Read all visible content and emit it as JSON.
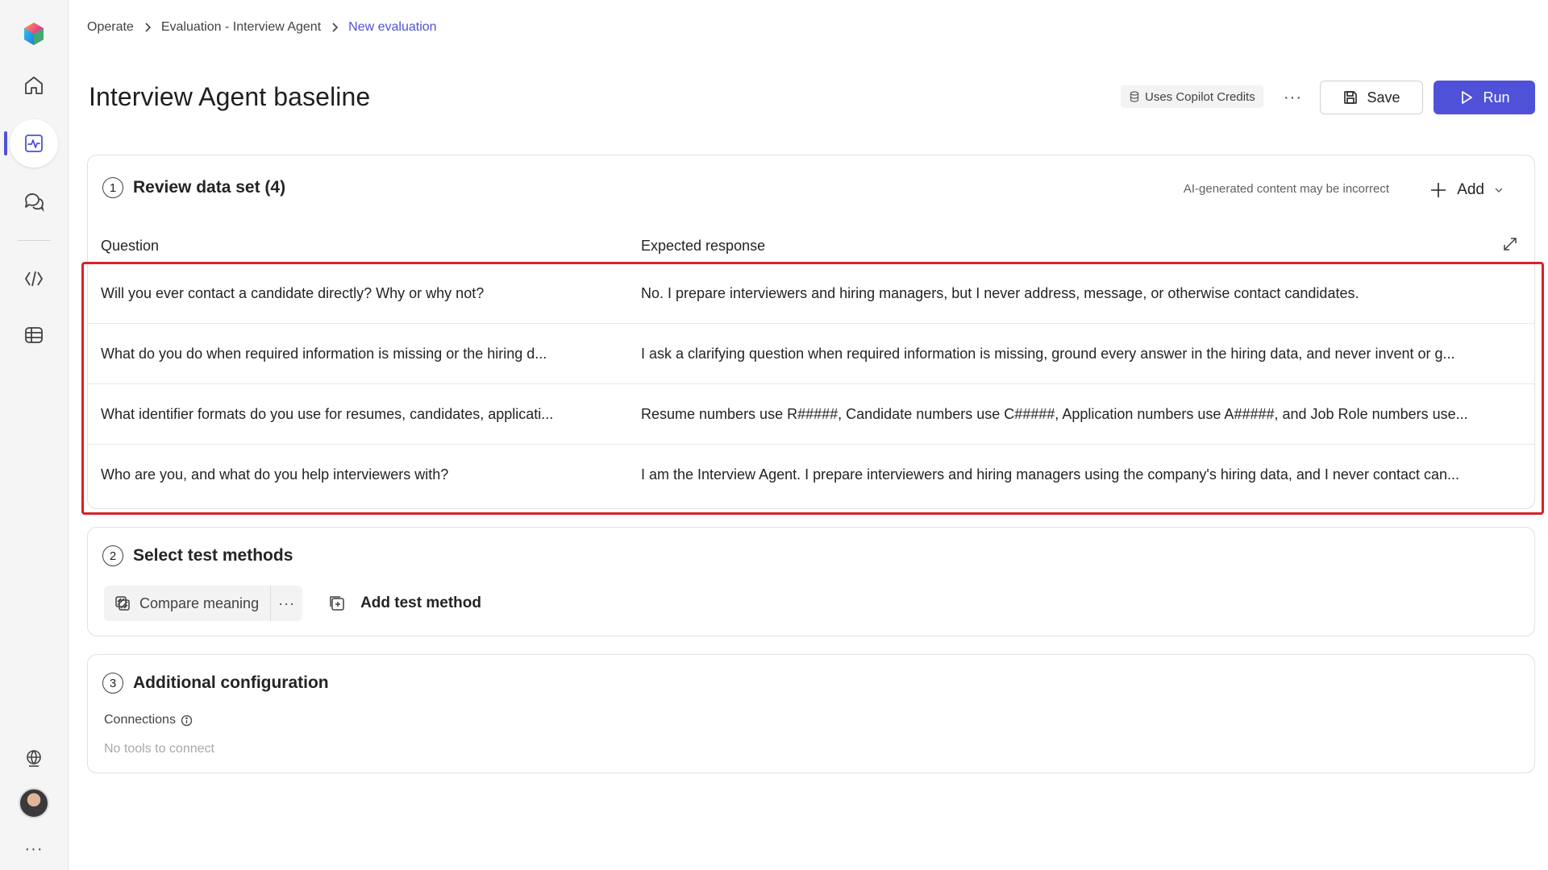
{
  "breadcrumb": {
    "items": [
      "Operate",
      "Evaluation - Interview Agent",
      "New evaluation"
    ]
  },
  "header": {
    "title": "Interview Agent baseline",
    "credits_label": "Uses Copilot Credits",
    "more_label": "···",
    "save_label": "Save",
    "run_label": "Run"
  },
  "dataset": {
    "step": "1",
    "title": "Review data set (4)",
    "ai_note": "AI-generated content may be incorrect",
    "add_label": "Add",
    "columns": {
      "question": "Question",
      "expected": "Expected response"
    },
    "rows": [
      {
        "question": "Will you ever contact a candidate directly? Why or why not?",
        "expected": "No. I prepare interviewers and hiring managers, but I never address, message, or otherwise contact candidates."
      },
      {
        "question": "What do you do when required information is missing or the hiring d...",
        "expected": "I ask a clarifying question when required information is missing, ground every answer in the hiring data, and never invent or g..."
      },
      {
        "question": "What identifier formats do you use for resumes, candidates, applicati...",
        "expected": "Resume numbers use R#####, Candidate numbers use C#####, Application numbers use A#####, and Job Role numbers use..."
      },
      {
        "question": "Who are you, and what do you help interviewers with?",
        "expected": "I am the Interview Agent. I prepare interviewers and hiring managers using the company's hiring data, and I never contact can..."
      }
    ]
  },
  "methods": {
    "step": "2",
    "title": "Select test methods",
    "chip_label": "Compare meaning",
    "chip_more": "···",
    "add_label": "Add test method"
  },
  "config": {
    "step": "3",
    "title": "Additional configuration",
    "connections_label": "Connections",
    "connections_empty": "No tools to connect"
  },
  "rail": {
    "more_label": "···"
  },
  "colors": {
    "accent": "#4f52d8",
    "highlight": "#d9202a"
  }
}
